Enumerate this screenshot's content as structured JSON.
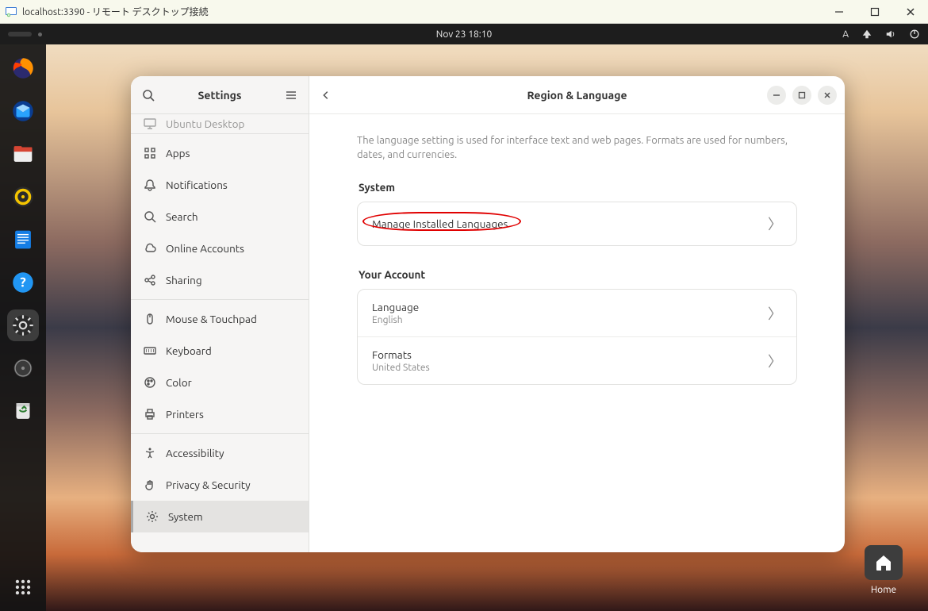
{
  "window": {
    "title": "localhost:3390 - リモート デスクトップ接続"
  },
  "topbar": {
    "datetime": "Nov 23  18:10",
    "input_indicator": "A"
  },
  "dock": {
    "items": [
      "firefox",
      "thunderbird",
      "files",
      "rhythmbox",
      "libreoffice-writer",
      "help",
      "settings",
      "disk-utility",
      "trash"
    ]
  },
  "desktop": {
    "home_label": "Home"
  },
  "settings": {
    "sidebar_title": "Settings",
    "nav_groups": [
      {
        "items": [
          {
            "id": "ubuntu-desktop",
            "label": "Ubuntu Desktop",
            "icon": "monitor",
            "partial": true
          }
        ]
      },
      {
        "items": [
          {
            "id": "apps",
            "label": "Apps",
            "icon": "grid"
          },
          {
            "id": "notifications",
            "label": "Notifications",
            "icon": "bell"
          },
          {
            "id": "search",
            "label": "Search",
            "icon": "search"
          },
          {
            "id": "online-accounts",
            "label": "Online Accounts",
            "icon": "cloud"
          },
          {
            "id": "sharing",
            "label": "Sharing",
            "icon": "share"
          }
        ]
      },
      {
        "items": [
          {
            "id": "mouse-touchpad",
            "label": "Mouse & Touchpad",
            "icon": "mouse"
          },
          {
            "id": "keyboard",
            "label": "Keyboard",
            "icon": "keyboard"
          },
          {
            "id": "color",
            "label": "Color",
            "icon": "palette"
          },
          {
            "id": "printers",
            "label": "Printers",
            "icon": "printer"
          }
        ]
      },
      {
        "items": [
          {
            "id": "accessibility",
            "label": "Accessibility",
            "icon": "accessibility"
          },
          {
            "id": "privacy-security",
            "label": "Privacy & Security",
            "icon": "hand"
          },
          {
            "id": "system",
            "label": "System",
            "icon": "gear",
            "selected": true
          }
        ]
      }
    ],
    "content": {
      "title": "Region & Language",
      "intro": "The language setting is used for interface text and web pages. Formats are used for numbers, dates, and currencies.",
      "sections": [
        {
          "heading": "System",
          "rows": [
            {
              "id": "manage-installed-languages",
              "title": "Manage Installed Languages",
              "highlighted": true
            }
          ]
        },
        {
          "heading": "Your Account",
          "rows": [
            {
              "id": "language",
              "title": "Language",
              "subtitle": "English"
            },
            {
              "id": "formats",
              "title": "Formats",
              "subtitle": "United States"
            }
          ]
        }
      ]
    }
  }
}
